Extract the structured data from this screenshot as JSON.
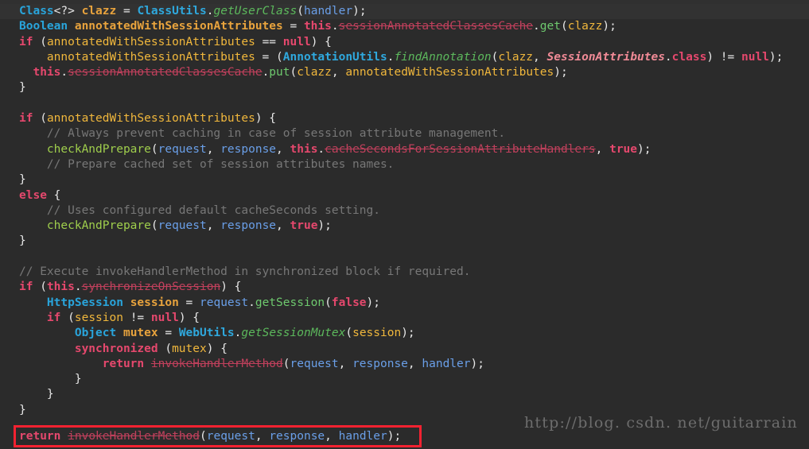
{
  "editor": {
    "background_color": "#2b2b2b",
    "caret_line_color": "#323232",
    "selection_color": "#184a54",
    "highlight_box_color": "#f42231"
  },
  "watermark": {
    "text": "http://blog. csdn. net/guitarrain"
  },
  "code": {
    "language": "Java",
    "lines": [
      {
        "n": 1,
        "tokens": [
          {
            "t": "Class",
            "c": "t-type"
          },
          {
            "t": "<?> ",
            "c": "t-punct"
          },
          {
            "t": "clazz",
            "c": "t-var"
          },
          {
            "t": " = ",
            "c": "t-punct"
          },
          {
            "t": "ClassUtils",
            "c": "t-cls"
          },
          {
            "t": ".",
            "c": "t-punct"
          },
          {
            "t": "getUserClass",
            "c": "t-meth"
          },
          {
            "t": "(",
            "c": "t-punct"
          },
          {
            "t": "handler",
            "c": "t-param"
          },
          {
            "t": ");",
            "c": "t-punct"
          }
        ]
      },
      {
        "n": 2,
        "tokens": [
          {
            "t": "Boolean",
            "c": "t-type"
          },
          {
            "t": " ",
            "c": "t-punct"
          },
          {
            "t": "annotatedWithSessionAttributes",
            "c": "t-var"
          },
          {
            "t": " = ",
            "c": "t-punct"
          },
          {
            "t": "this",
            "c": "t-kw"
          },
          {
            "t": ".",
            "c": "t-punct"
          },
          {
            "t": "sessionAnnotatedClassesCache",
            "c": "t-strike"
          },
          {
            "t": ".",
            "c": "t-punct"
          },
          {
            "t": "get",
            "c": "t-meth2"
          },
          {
            "t": "(",
            "c": "t-punct"
          },
          {
            "t": "clazz",
            "c": "t-ident"
          },
          {
            "t": ");",
            "c": "t-punct"
          }
        ]
      },
      {
        "n": 3,
        "tokens": [
          {
            "t": "if",
            "c": "t-kw"
          },
          {
            "t": " (",
            "c": "t-punct"
          },
          {
            "t": "annotatedWithSessionAttributes",
            "c": "t-ident"
          },
          {
            "t": " == ",
            "c": "t-punct"
          },
          {
            "t": "null",
            "c": "t-kw"
          },
          {
            "t": ") {",
            "c": "t-punct"
          }
        ]
      },
      {
        "n": 4,
        "tokens": [
          {
            "t": "    ",
            "c": "t-punct"
          },
          {
            "t": "annotatedWithSessionAttributes",
            "c": "t-ident"
          },
          {
            "t": " = (",
            "c": "t-punct"
          },
          {
            "t": "AnnotationUtils",
            "c": "t-cls"
          },
          {
            "t": ".",
            "c": "t-punct"
          },
          {
            "t": "findAnnotation",
            "c": "t-meth"
          },
          {
            "t": "(",
            "c": "t-punct"
          },
          {
            "t": "clazz",
            "c": "t-ident"
          },
          {
            "t": ", ",
            "c": "t-punct"
          },
          {
            "t": "SessionAttributes",
            "c": "t-annot"
          },
          {
            "t": ".",
            "c": "t-punct"
          },
          {
            "t": "class",
            "c": "t-kw"
          },
          {
            "t": ") != ",
            "c": "t-punct"
          },
          {
            "t": "null",
            "c": "t-kw"
          },
          {
            "t": ");",
            "c": "t-punct"
          }
        ]
      },
      {
        "n": 5,
        "tokens": [
          {
            "t": "  ",
            "c": "t-punct"
          },
          {
            "t": "this",
            "c": "t-kw"
          },
          {
            "t": ".",
            "c": "t-punct"
          },
          {
            "t": "sessionAnnotatedClassesCache",
            "c": "t-strike"
          },
          {
            "t": ".",
            "c": "t-punct"
          },
          {
            "t": "put",
            "c": "t-meth2"
          },
          {
            "t": "(",
            "c": "t-punct"
          },
          {
            "t": "clazz",
            "c": "t-ident"
          },
          {
            "t": ", ",
            "c": "t-punct"
          },
          {
            "t": "annotatedWithSessionAttributes",
            "c": "t-ident"
          },
          {
            "t": ");",
            "c": "t-punct"
          }
        ]
      },
      {
        "n": 6,
        "tokens": [
          {
            "t": "}",
            "c": "t-punct"
          }
        ]
      },
      {
        "n": 7,
        "tokens": []
      },
      {
        "n": 8,
        "tokens": [
          {
            "t": "if",
            "c": "t-kw"
          },
          {
            "t": " (",
            "c": "t-punct"
          },
          {
            "t": "annotatedWithSessionAttributes",
            "c": "t-ident"
          },
          {
            "t": ") {",
            "c": "t-punct"
          }
        ]
      },
      {
        "n": 9,
        "tokens": [
          {
            "t": "    // Always prevent caching in case of session attribute management.",
            "c": "t-cmt"
          }
        ]
      },
      {
        "n": 10,
        "tokens": [
          {
            "t": "    ",
            "c": "t-punct"
          },
          {
            "t": "checkAndPrepare",
            "c": "t-fn"
          },
          {
            "t": "(",
            "c": "t-punct"
          },
          {
            "t": "request",
            "c": "t-param"
          },
          {
            "t": ", ",
            "c": "t-punct"
          },
          {
            "t": "response",
            "c": "t-param"
          },
          {
            "t": ", ",
            "c": "t-punct"
          },
          {
            "t": "this",
            "c": "t-kw"
          },
          {
            "t": ".",
            "c": "t-punct"
          },
          {
            "t": "cacheSecondsForSessionAttributeHandlers",
            "c": "t-strike"
          },
          {
            "t": ", ",
            "c": "t-punct"
          },
          {
            "t": "true",
            "c": "t-kw"
          },
          {
            "t": ");",
            "c": "t-punct"
          }
        ]
      },
      {
        "n": 11,
        "tokens": [
          {
            "t": "    // Prepare cached set of session attributes names.",
            "c": "t-cmt"
          }
        ]
      },
      {
        "n": 12,
        "tokens": [
          {
            "t": "}",
            "c": "t-punct"
          }
        ]
      },
      {
        "n": 13,
        "tokens": [
          {
            "t": "else",
            "c": "t-kw"
          },
          {
            "t": " {",
            "c": "t-punct"
          }
        ]
      },
      {
        "n": 14,
        "tokens": [
          {
            "t": "    // Uses configured default cacheSeconds setting.",
            "c": "t-cmt"
          }
        ]
      },
      {
        "n": 15,
        "tokens": [
          {
            "t": "    ",
            "c": "t-punct"
          },
          {
            "t": "checkAndPrepare",
            "c": "t-fn"
          },
          {
            "t": "(",
            "c": "t-punct"
          },
          {
            "t": "request",
            "c": "t-param"
          },
          {
            "t": ", ",
            "c": "t-punct"
          },
          {
            "t": "response",
            "c": "t-param"
          },
          {
            "t": ", ",
            "c": "t-punct"
          },
          {
            "t": "true",
            "c": "t-kw"
          },
          {
            "t": ");",
            "c": "t-punct"
          }
        ]
      },
      {
        "n": 16,
        "tokens": [
          {
            "t": "}",
            "c": "t-punct"
          }
        ]
      },
      {
        "n": 17,
        "tokens": []
      },
      {
        "n": 18,
        "tokens": [
          {
            "t": "// Execute invokeHandlerMethod in synchronized block if required.",
            "c": "t-cmt"
          }
        ]
      },
      {
        "n": 19,
        "tokens": [
          {
            "t": "if",
            "c": "t-kw"
          },
          {
            "t": " (",
            "c": "t-punct"
          },
          {
            "t": "this",
            "c": "t-kw"
          },
          {
            "t": ".",
            "c": "t-punct"
          },
          {
            "t": "synchronizeOnSession",
            "c": "t-strike"
          },
          {
            "t": ") {",
            "c": "t-punct"
          }
        ]
      },
      {
        "n": 20,
        "tokens": [
          {
            "t": "    ",
            "c": "t-punct"
          },
          {
            "t": "HttpSession",
            "c": "t-type"
          },
          {
            "t": " ",
            "c": "t-punct"
          },
          {
            "t": "session",
            "c": "t-var"
          },
          {
            "t": " = ",
            "c": "t-punct"
          },
          {
            "t": "request",
            "c": "t-param"
          },
          {
            "t": ".",
            "c": "t-punct"
          },
          {
            "t": "getSession",
            "c": "t-meth2"
          },
          {
            "t": "(",
            "c": "t-punct"
          },
          {
            "t": "false",
            "c": "t-kw"
          },
          {
            "t": ");",
            "c": "t-punct"
          }
        ]
      },
      {
        "n": 21,
        "tokens": [
          {
            "t": "    ",
            "c": "t-punct"
          },
          {
            "t": "if",
            "c": "t-kw"
          },
          {
            "t": " (",
            "c": "t-punct"
          },
          {
            "t": "session",
            "c": "t-ident"
          },
          {
            "t": " != ",
            "c": "t-punct"
          },
          {
            "t": "null",
            "c": "t-kw"
          },
          {
            "t": ") {",
            "c": "t-punct"
          }
        ]
      },
      {
        "n": 22,
        "tokens": [
          {
            "t": "        ",
            "c": "t-punct"
          },
          {
            "t": "Object",
            "c": "t-type"
          },
          {
            "t": " ",
            "c": "t-punct"
          },
          {
            "t": "mutex",
            "c": "t-var"
          },
          {
            "t": " = ",
            "c": "t-punct"
          },
          {
            "t": "WebUtils",
            "c": "t-cls"
          },
          {
            "t": ".",
            "c": "t-punct"
          },
          {
            "t": "getSessionMutex",
            "c": "t-meth"
          },
          {
            "t": "(",
            "c": "t-punct"
          },
          {
            "t": "session",
            "c": "t-ident"
          },
          {
            "t": ");",
            "c": "t-punct"
          }
        ]
      },
      {
        "n": 23,
        "tokens": [
          {
            "t": "        ",
            "c": "t-punct"
          },
          {
            "t": "synchronized",
            "c": "t-kw"
          },
          {
            "t": " (",
            "c": "t-punct"
          },
          {
            "t": "mutex",
            "c": "t-ident"
          },
          {
            "t": ") {",
            "c": "t-punct"
          }
        ]
      },
      {
        "n": 24,
        "tokens": [
          {
            "t": "            ",
            "c": "t-punct"
          },
          {
            "t": "return",
            "c": "t-kw"
          },
          {
            "t": " ",
            "c": "t-punct"
          },
          {
            "t": "invokeHandlerMethod",
            "c": "t-strike"
          },
          {
            "t": "(",
            "c": "t-punct"
          },
          {
            "t": "request",
            "c": "t-param"
          },
          {
            "t": ", ",
            "c": "t-punct"
          },
          {
            "t": "response",
            "c": "t-param"
          },
          {
            "t": ", ",
            "c": "t-punct"
          },
          {
            "t": "handler",
            "c": "t-param"
          },
          {
            "t": ");",
            "c": "t-punct"
          }
        ]
      },
      {
        "n": 25,
        "tokens": [
          {
            "t": "        }",
            "c": "t-punct"
          }
        ]
      },
      {
        "n": 26,
        "tokens": [
          {
            "t": "    }",
            "c": "t-punct"
          }
        ]
      },
      {
        "n": 27,
        "tokens": [
          {
            "t": "}",
            "c": "t-punct"
          }
        ]
      },
      {
        "n": 28,
        "tokens": []
      }
    ],
    "highlighted_line": {
      "n": 29,
      "tokens": [
        {
          "t": "return",
          "c": "t-kw"
        },
        {
          "t": " ",
          "c": "t-punct"
        },
        {
          "t": "invokeHandlerMethod",
          "c": "t-strike"
        },
        {
          "t": "(",
          "c": "t-punct"
        },
        {
          "t": "request",
          "c": "t-param"
        },
        {
          "t": ", ",
          "c": "t-punct"
        },
        {
          "t": "response",
          "c": "t-param"
        },
        {
          "t": ", ",
          "c": "t-punct"
        },
        {
          "t": "handler",
          "c": "t-param"
        },
        {
          "t": ");",
          "c": "t-punct"
        }
      ]
    }
  }
}
